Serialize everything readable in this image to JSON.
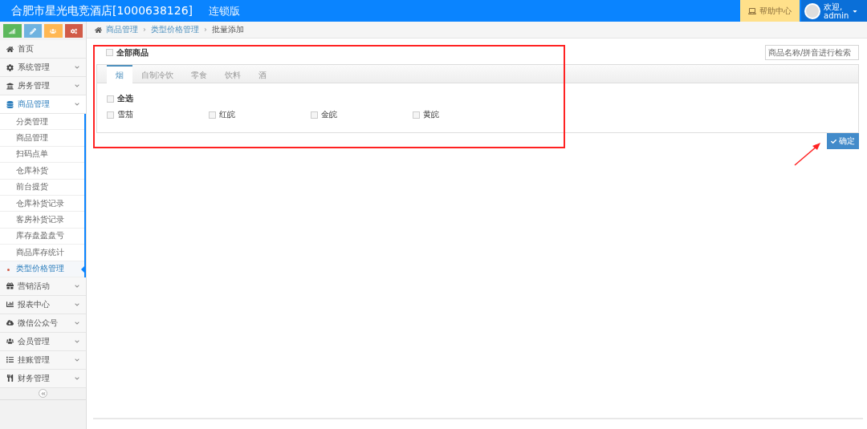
{
  "header": {
    "title": "合肥市星光电竞酒店[1000638126]",
    "edition": "连锁版",
    "help": "帮助中心",
    "welcome": "欢迎,",
    "user": "admin"
  },
  "shortcuts": [
    {
      "color": "#5cb85c"
    },
    {
      "color": "#6fb3e0"
    },
    {
      "color": "#ffb752"
    },
    {
      "color": "#d15b47"
    }
  ],
  "sidebar": {
    "items": [
      {
        "label": "首页",
        "kind": "link"
      },
      {
        "label": "系统管理",
        "kind": "group",
        "expanded": false
      },
      {
        "label": "房务管理",
        "kind": "group",
        "expanded": false
      },
      {
        "label": "商品管理",
        "kind": "group",
        "expanded": true,
        "children": [
          {
            "label": "分类管理",
            "selected": false
          },
          {
            "label": "商品管理",
            "selected": false
          },
          {
            "label": "扫码点单",
            "selected": false
          },
          {
            "label": "仓库补货",
            "selected": false
          },
          {
            "label": "前台提货",
            "selected": false
          },
          {
            "label": "仓库补货记录",
            "selected": false
          },
          {
            "label": "客房补货记录",
            "selected": false
          },
          {
            "label": "库存盘盈盘亏",
            "selected": false
          },
          {
            "label": "商品库存统计",
            "selected": false
          },
          {
            "label": "类型价格管理",
            "selected": true
          }
        ]
      },
      {
        "label": "营销活动",
        "kind": "group",
        "expanded": false
      },
      {
        "label": "报表中心",
        "kind": "group",
        "expanded": false
      },
      {
        "label": "微信公众号",
        "kind": "group",
        "expanded": false
      },
      {
        "label": "会员管理",
        "kind": "group",
        "expanded": false
      },
      {
        "label": "挂账管理",
        "kind": "group",
        "expanded": false
      },
      {
        "label": "财务管理",
        "kind": "group",
        "expanded": false
      }
    ]
  },
  "breadcrumb": [
    "商品管理",
    "类型价格管理",
    "批量添加"
  ],
  "all_goods": {
    "label": "全部商品",
    "checked": false
  },
  "search": {
    "placeholder": "商品名称/拼音进行检索"
  },
  "tabs": [
    {
      "label": "烟",
      "selected": true
    },
    {
      "label": "自制冷饮",
      "selected": false
    },
    {
      "label": "零食",
      "selected": false
    },
    {
      "label": "饮料",
      "selected": false
    },
    {
      "label": "酒",
      "selected": false
    }
  ],
  "select_all": {
    "label": "全选",
    "checked": false
  },
  "products": [
    {
      "label": "雪茄",
      "checked": false
    },
    {
      "label": "红皖",
      "checked": false
    },
    {
      "label": "金皖",
      "checked": false
    },
    {
      "label": "黄皖",
      "checked": false
    }
  ],
  "confirm": "确定"
}
